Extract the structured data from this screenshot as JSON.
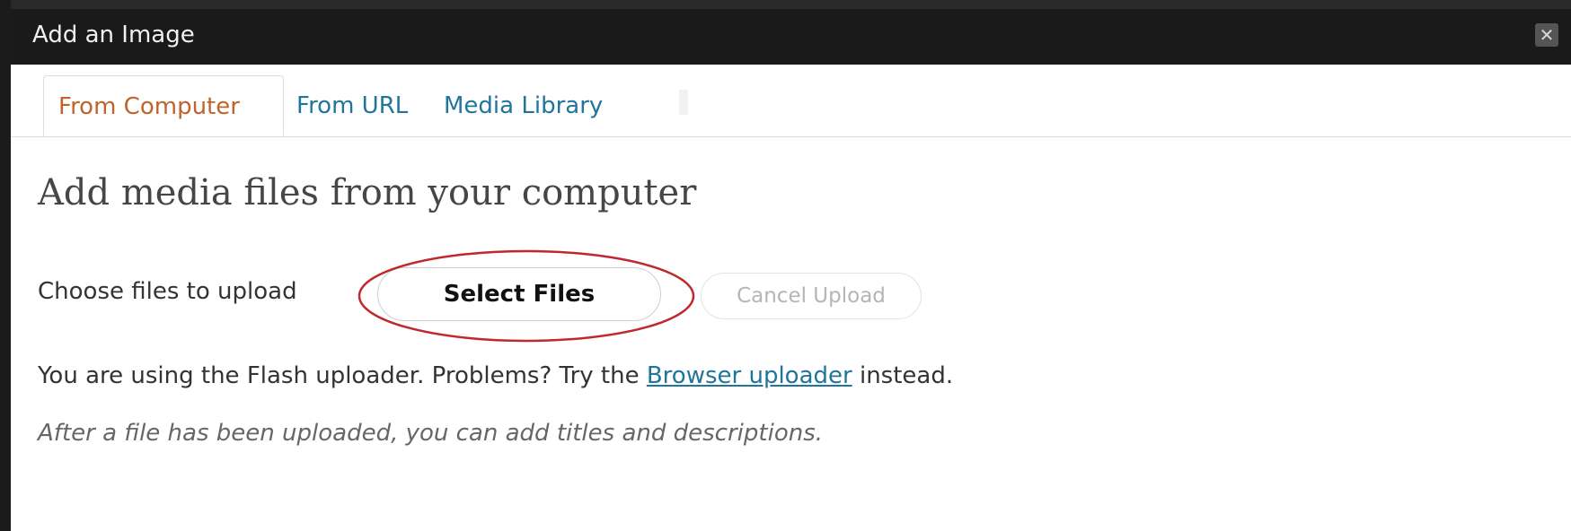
{
  "dialog": {
    "title": "Add an Image",
    "close_symbol": "✕"
  },
  "tabs": [
    {
      "label": "From Computer",
      "active": true
    },
    {
      "label": "From URL",
      "active": false
    },
    {
      "label": "Media Library",
      "active": false
    }
  ],
  "content": {
    "heading": "Add media files from your computer",
    "choose_label": "Choose files to upload",
    "select_files_label": "Select Files",
    "cancel_upload_label": "Cancel Upload",
    "flash_text_before": "You are using the Flash uploader. Problems? Try the ",
    "browser_uploader_link": "Browser uploader",
    "flash_text_after": " instead.",
    "after_upload_note": "After a file has been uploaded, you can add titles and descriptions."
  },
  "icons": {
    "close": "close-icon"
  },
  "colors": {
    "titlebar": "#1a1a1a",
    "active_tab": "#c0632d",
    "link": "#21759b",
    "annotation": "#c0282d"
  }
}
